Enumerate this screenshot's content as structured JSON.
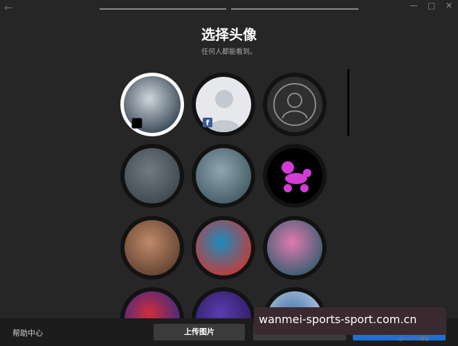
{
  "header": {
    "title": "选择头像",
    "subtitle": "任何人都能看到。"
  },
  "window_controls": {
    "minimize": "—",
    "maximize": "□",
    "close": "✕"
  },
  "avatars": {
    "selected_index": 0,
    "items": [
      {
        "name": "character-with-visor",
        "colors": [
          "#cfd6dc",
          "#2b3a4a"
        ]
      },
      {
        "name": "facebook-default-silhouette",
        "colors": [
          "#e6e8ec",
          "#c4c8cf"
        ]
      },
      {
        "name": "default-person-outline",
        "colors": [
          "#2f2f2f",
          "#8c8c8c"
        ]
      },
      {
        "name": "grey-alien",
        "colors": [
          "#6f7a82",
          "#3b444a"
        ]
      },
      {
        "name": "blue-alien",
        "colors": [
          "#8fa6b0",
          "#3c5660"
        ]
      },
      {
        "name": "magenta-balloon-dog",
        "colors": [
          "#000000",
          "#d23cd4"
        ]
      },
      {
        "name": "brown-creature",
        "colors": [
          "#c08a6a",
          "#5a3c2c"
        ]
      },
      {
        "name": "blue-red-dragon",
        "colors": [
          "#1d8bbf",
          "#d0342c"
        ]
      },
      {
        "name": "colorful-woman",
        "colors": [
          "#e07ab0",
          "#2a5a6a"
        ]
      },
      {
        "name": "red-abstract",
        "colors": [
          "#d02c3c",
          "#2a2a8a"
        ]
      },
      {
        "name": "purple-creature",
        "colors": [
          "#5a3cb0",
          "#2a1a5a"
        ]
      },
      {
        "name": "blue-portrait",
        "colors": [
          "#4a78b0",
          "#c0d0e0"
        ]
      }
    ]
  },
  "footer": {
    "help_label": "帮助中心",
    "upload_label": "上传图片",
    "skip_label": "跳过",
    "next_label": "下一步"
  },
  "overlay": {
    "badge_text": "wanmei-sports-sport.com.cn",
    "watermark": "@51CTO博客"
  },
  "colors": {
    "background": "#262626",
    "accent": "#1e6fd9"
  }
}
